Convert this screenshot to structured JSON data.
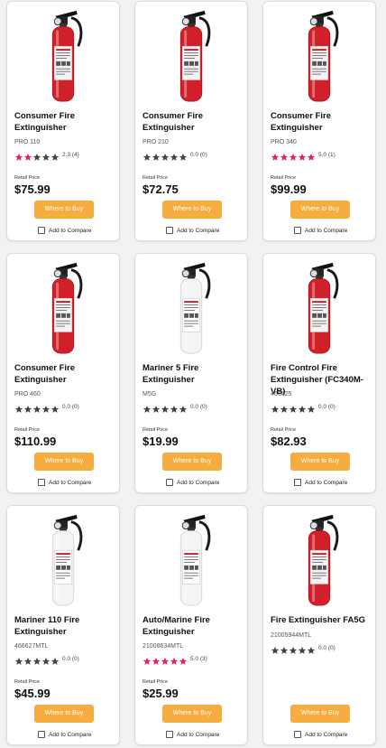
{
  "products": [
    {
      "title": "Consumer Fire Extinguisher",
      "sku": "PRO 110",
      "rating": 2.3,
      "rating_text": "2.3 (4)",
      "price_label": "Retail Price",
      "price": "$75.99",
      "buy_label": "Where to Buy",
      "compare_label": "Add to Compare",
      "image_icon": "red-fire-extinguisher-icon",
      "body_color": "#d1202a"
    },
    {
      "title": "Consumer Fire Extinguisher",
      "sku": "PRO 210",
      "rating": 0,
      "rating_text": "0.0 (0)",
      "price_label": "Retail Price",
      "price": "$72.75",
      "buy_label": "Where to Buy",
      "compare_label": "Add to Compare",
      "image_icon": "red-fire-extinguisher-icon",
      "body_color": "#d1202a"
    },
    {
      "title": "Consumer Fire Extinguisher",
      "sku": "PRO 340",
      "rating": 5,
      "rating_text": "5.0 (1)",
      "price_label": "Retail Price",
      "price": "$99.99",
      "buy_label": "Where to Buy",
      "compare_label": "Add to Compare",
      "image_icon": "red-fire-extinguisher-icon",
      "body_color": "#d1202a"
    },
    {
      "title": "Consumer Fire Extinguisher",
      "sku": "PRO 460",
      "rating": 0,
      "rating_text": "0.0 (0)",
      "price_label": "Retail Price",
      "price": "$110.99",
      "buy_label": "Where to Buy",
      "compare_label": "Add to Compare",
      "image_icon": "red-fire-extinguisher-icon",
      "body_color": "#d1202a"
    },
    {
      "title": "Mariner 5 Fire Extinguisher",
      "sku": "M5G",
      "rating": 0,
      "rating_text": "0.0 (0)",
      "price_label": "Retail Price",
      "price": "$19.99",
      "buy_label": "Where to Buy",
      "compare_label": "Add to Compare",
      "image_icon": "white-fire-extinguisher-icon",
      "body_color": "#f4f4f4"
    },
    {
      "title": "Fire Control Fire Extinguisher (FC340M-VB)",
      "sku": "466425",
      "rating": 0,
      "rating_text": "0.0 (0)",
      "price_label": "Retail Price",
      "price": "$82.93",
      "buy_label": "Where to Buy",
      "compare_label": "Add to Compare",
      "image_icon": "red-fire-extinguisher-icon",
      "body_color": "#d1202a"
    },
    {
      "title": "Mariner 110 Fire Extinguisher",
      "sku": "466627MTL",
      "rating": 0,
      "rating_text": "0.0 (0)",
      "price_label": "Retail Price",
      "price": "$45.99",
      "buy_label": "Where to Buy",
      "compare_label": "Add to Compare",
      "image_icon": "white-fire-extinguisher-icon",
      "body_color": "#f4f4f4"
    },
    {
      "title": "Auto/Marine Fire Extinguisher",
      "sku": "21008634MTL",
      "rating": 5,
      "rating_text": "5.0 (3)",
      "price_label": "Retail Price",
      "price": "$25.99",
      "buy_label": "Where to Buy",
      "compare_label": "Add to Compare",
      "image_icon": "white-fire-extinguisher-icon",
      "body_color": "#f4f4f4"
    },
    {
      "title": "Fire Extinguisher FA5G",
      "sku": "21005944MTL",
      "rating": 0,
      "rating_text": "0.0 (0)",
      "price_label": "",
      "price": "",
      "buy_label": "Where to Buy",
      "compare_label": "Add to Compare",
      "image_icon": "red-fire-extinguisher-icon",
      "body_color": "#d1202a"
    }
  ],
  "colors": {
    "star_filled": "#e0245e",
    "star_empty": "#444444",
    "button": "#f6ac3f"
  }
}
